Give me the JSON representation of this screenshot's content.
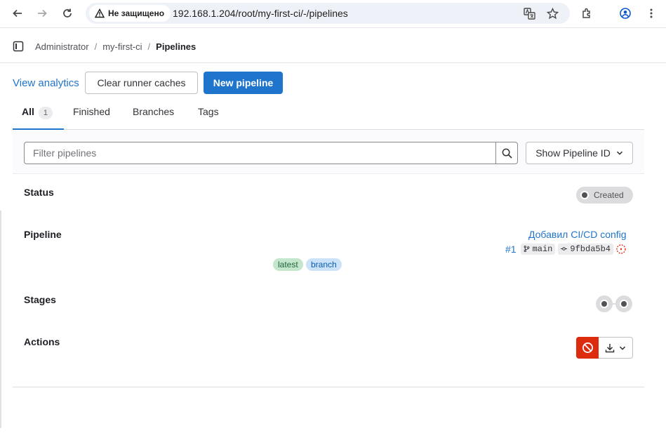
{
  "browser": {
    "security_label": "Не защищено",
    "url": "192.168.1.204/root/my-first-ci/-/pipelines",
    "icons": [
      "back-icon",
      "forward-icon",
      "reload-icon",
      "warning-icon",
      "translate-icon",
      "star-icon",
      "extensions-icon",
      "profile-icon",
      "menu-icon"
    ]
  },
  "breadcrumb": {
    "items": [
      "Administrator",
      "my-first-ci",
      "Pipelines"
    ],
    "separator": "/"
  },
  "actions": {
    "view_analytics": "View analytics",
    "clear_caches": "Clear runner caches",
    "new_pipeline": "New pipeline"
  },
  "tabs": [
    {
      "label": "All",
      "count": "1",
      "active": true
    },
    {
      "label": "Finished"
    },
    {
      "label": "Branches"
    },
    {
      "label": "Tags"
    }
  ],
  "filter": {
    "placeholder": "Filter pipelines",
    "show_id_label": "Show Pipeline ID"
  },
  "pipeline": {
    "status_label": "Status",
    "status": "Created",
    "pipeline_label": "Pipeline",
    "commit_title": "Добавил CI/CD config",
    "id": "#1",
    "ref": "main",
    "sha": "9fbda5b4",
    "labels": [
      "latest",
      "branch"
    ],
    "stages_label": "Stages",
    "stages_count": 2,
    "actions_label": "Actions"
  },
  "colors": {
    "link": "#1f75cb",
    "danger": "#dd2b0e",
    "badge_latest": "#c3e6cd",
    "badge_branch": "#cbe2f9",
    "status_created": "#dcdcde"
  }
}
